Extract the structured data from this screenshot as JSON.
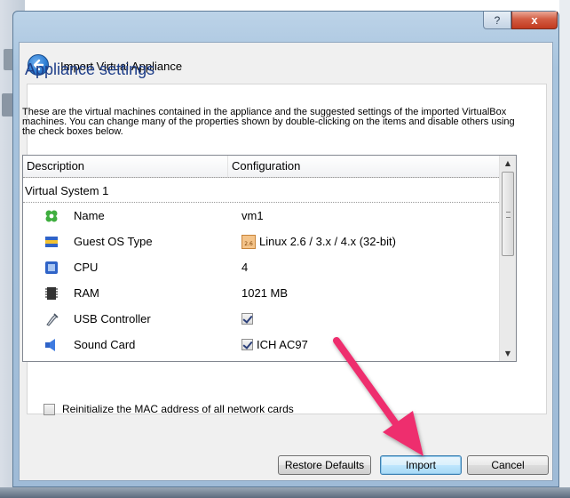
{
  "window": {
    "title": "Import Virtual Appliance",
    "help_label": "?",
    "close_label": "x"
  },
  "page": {
    "heading": "Appliance settings",
    "description": "These are the virtual machines contained in the appliance and the suggested settings of the imported VirtualBox machines. You can change many of the properties shown by double-clicking on the items and disable others using the check boxes below."
  },
  "table": {
    "headers": {
      "description": "Description",
      "configuration": "Configuration"
    },
    "group_label": "Virtual System 1",
    "rows": [
      {
        "label": "Name",
        "value": "vm1",
        "icon": "name-icon"
      },
      {
        "label": "Guest OS Type",
        "value": "Linux 2.6 / 3.x / 4.x (32-bit)",
        "icon": "guest-os-icon",
        "value_icon": "linux-os-icon",
        "value_icon_text": "2.6"
      },
      {
        "label": "CPU",
        "value": "4",
        "icon": "cpu-icon"
      },
      {
        "label": "RAM",
        "value": "1021 MB",
        "icon": "ram-icon"
      },
      {
        "label": "USB Controller",
        "value": "",
        "icon": "usb-icon",
        "checked": true
      },
      {
        "label": "Sound Card",
        "value": "ICH AC97",
        "icon": "sound-card-icon",
        "checked": true
      }
    ]
  },
  "options": {
    "reinit_mac_label": "Reinitialize the MAC address of all network cards",
    "reinit_mac_checked": false
  },
  "buttons": {
    "restore_defaults": "Restore Defaults",
    "import": "Import",
    "cancel": "Cancel"
  },
  "colors": {
    "heading": "#1f3f8a",
    "annotation_arrow": "#ee2d6e"
  }
}
